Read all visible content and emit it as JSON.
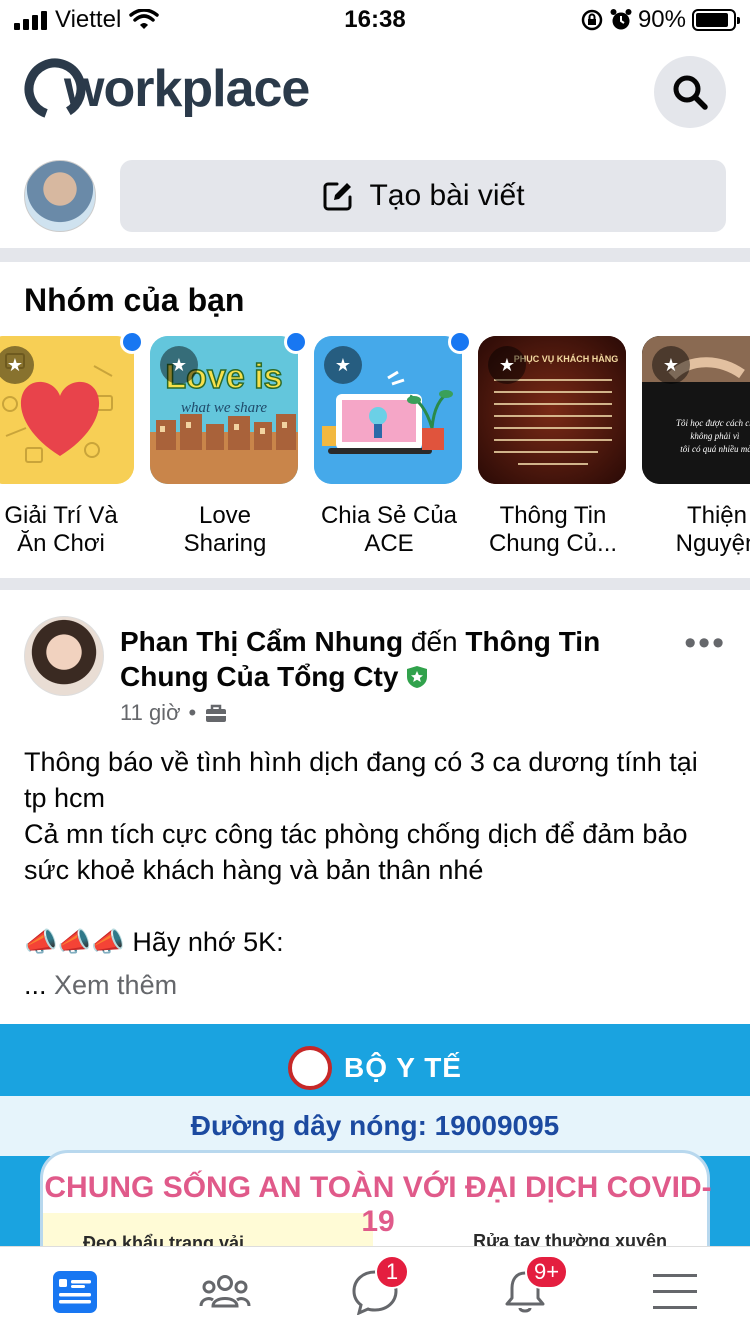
{
  "status_bar": {
    "carrier": "Viettel",
    "time": "16:38",
    "battery": "90%",
    "battery_level": 0.9,
    "icons": [
      "signal-icon",
      "wifi-icon",
      "rotation-lock-icon",
      "alarm-icon",
      "battery-icon"
    ]
  },
  "header": {
    "app_name": "workplace",
    "search_icon": "search-icon"
  },
  "composer": {
    "create_label": "Tạo bài viết",
    "icon": "edit-icon"
  },
  "groups": {
    "title": "Nhóm của bạn",
    "items": [
      {
        "name": "Giải Trí Và Ăn Chơi",
        "line1": "Giải Trí Và",
        "line2": "Ăn Chơi",
        "unread": true
      },
      {
        "name": "Love Sharing",
        "line1": "Love",
        "line2": "Sharing",
        "unread": true
      },
      {
        "name": "Chia Sẻ Của ACE",
        "line1": "Chia Sẻ Của",
        "line2": "ACE",
        "unread": true
      },
      {
        "name": "Thông Tin Chung Củ...",
        "line1": "Thông Tin",
        "line2": "Chung Củ...",
        "unread": false
      },
      {
        "name": "Thiện Nguyện",
        "line1": "Thiện",
        "line2": "Nguyện",
        "unread": false
      }
    ],
    "thumb_texts": {
      "love_sharing_big": "Love is",
      "love_sharing_small": "what we share",
      "thong_tin_header": "PHỤC VỤ KHÁCH HÀNG",
      "thien_nguyen_text": "Tôi học được cách ch không phải vì tôi có quá nhiều mà tôi hiểu rất rõ cảm giá của người không"
    }
  },
  "post": {
    "author": "Phan Thị Cẩm Nhung",
    "connector": "đến",
    "group": "Thông Tin Chung Của Tổng Cty",
    "time": "11 giờ",
    "meta_separator": "•",
    "body": "Thông báo về tình hình dịch đang có 3 ca dương tính tại tp hcm\nCả mn tích cực công tác phòng chống dịch để đảm bảo sức khoẻ khách hàng và bản thân nhé\n\n📣📣📣 Hãy nhớ 5K:",
    "see_more_dots": "...",
    "see_more": "Xem thêm",
    "image": {
      "ministry": "BỘ Y TẾ",
      "hotline": "Đường dây nóng: 19009095",
      "headline": "CHUNG SỐNG AN TOÀN VỚI ĐẠI DỊCH COVID-19",
      "tip_left": "Đeo khẩu trang vải",
      "tip_right": "Rửa tay thường xuyên"
    }
  },
  "bottom_nav": {
    "items": [
      {
        "name": "feed",
        "icon": "news-feed-icon",
        "active": true
      },
      {
        "name": "groups",
        "icon": "groups-icon",
        "active": false
      },
      {
        "name": "chat",
        "icon": "chat-icon",
        "badge": "1"
      },
      {
        "name": "notifications",
        "icon": "bell-icon",
        "badge": "9+"
      },
      {
        "name": "menu",
        "icon": "menu-icon"
      }
    ]
  },
  "colors": {
    "accent": "#1877f2",
    "badge": "#e41e3f",
    "gray_bg": "#e4e6eb",
    "text_secondary": "#65676b"
  }
}
